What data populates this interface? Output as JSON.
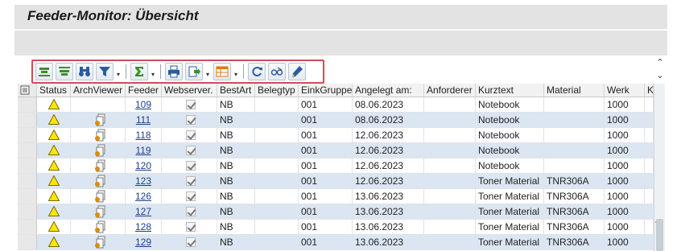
{
  "title": "Feeder-Monitor: Übersicht",
  "toolbar": {
    "buttons": [
      {
        "name": "sort-ascending-button",
        "icon": "sort-ascending-icon"
      },
      {
        "name": "sort-descending-button",
        "icon": "sort-descending-icon"
      },
      {
        "name": "find-button",
        "icon": "binoculars-icon"
      },
      {
        "name": "filter-button",
        "icon": "filter-icon"
      },
      {
        "name": "total-button",
        "icon": "sigma-icon"
      },
      {
        "name": "print-button",
        "icon": "printer-icon"
      },
      {
        "name": "export-button",
        "icon": "export-icon"
      },
      {
        "name": "layout-button",
        "icon": "layout-grid-icon"
      },
      {
        "name": "refresh-button",
        "icon": "refresh-icon"
      },
      {
        "name": "display-change-button",
        "icon": "glasses-icon"
      },
      {
        "name": "edit-button",
        "icon": "pencil-icon"
      }
    ]
  },
  "columns": [
    "Status",
    "ArchViewer",
    "Feeder",
    "Webserver.",
    "BestArt",
    "Belegtyp",
    "EinkGruppe",
    "Angelegt am:",
    "Anforderer",
    "Kurztext",
    "Material",
    "Werk",
    "Ku"
  ],
  "rows": [
    {
      "feeder": "109",
      "bestart": "NB",
      "eink": "001",
      "angelegt": "08.06.2023",
      "kurztext": "Notebook",
      "material": "",
      "werk": "1000",
      "arch": false
    },
    {
      "feeder": "111",
      "bestart": "NB",
      "eink": "001",
      "angelegt": "08.06.2023",
      "kurztext": "Notebook",
      "material": "",
      "werk": "1000",
      "arch": true
    },
    {
      "feeder": "118",
      "bestart": "NB",
      "eink": "001",
      "angelegt": "12.06.2023",
      "kurztext": "Notebook",
      "material": "",
      "werk": "1000",
      "arch": true
    },
    {
      "feeder": "119",
      "bestart": "NB",
      "eink": "001",
      "angelegt": "12.06.2023",
      "kurztext": "Notebook",
      "material": "",
      "werk": "1000",
      "arch": true
    },
    {
      "feeder": "120",
      "bestart": "NB",
      "eink": "001",
      "angelegt": "12.06.2023",
      "kurztext": "Notebook",
      "material": "",
      "werk": "1000",
      "arch": true
    },
    {
      "feeder": "123",
      "bestart": "NB",
      "eink": "001",
      "angelegt": "12.06.2023",
      "kurztext": "Toner Material",
      "material": "TNR306A",
      "werk": "1000",
      "arch": true
    },
    {
      "feeder": "126",
      "bestart": "NB",
      "eink": "001",
      "angelegt": "13.06.2023",
      "kurztext": "Toner Material",
      "material": "TNR306A",
      "werk": "1000",
      "arch": true
    },
    {
      "feeder": "127",
      "bestart": "NB",
      "eink": "001",
      "angelegt": "13.06.2023",
      "kurztext": "Toner Material",
      "material": "TNR306A",
      "werk": "1000",
      "arch": true
    },
    {
      "feeder": "128",
      "bestart": "NB",
      "eink": "001",
      "angelegt": "13.06.2023",
      "kurztext": "Toner Material",
      "material": "TNR306A",
      "werk": "1000",
      "arch": true
    },
    {
      "feeder": "129",
      "bestart": "NB",
      "eink": "001",
      "angelegt": "13.06.2023",
      "kurztext": "Toner Material",
      "material": "TNR306A",
      "werk": "1000",
      "arch": true
    }
  ],
  "colors": {
    "highlight": "#d24d57",
    "row_alt": "#dce6f2",
    "warning": "#ffe600",
    "link": "#1f3f8a"
  }
}
